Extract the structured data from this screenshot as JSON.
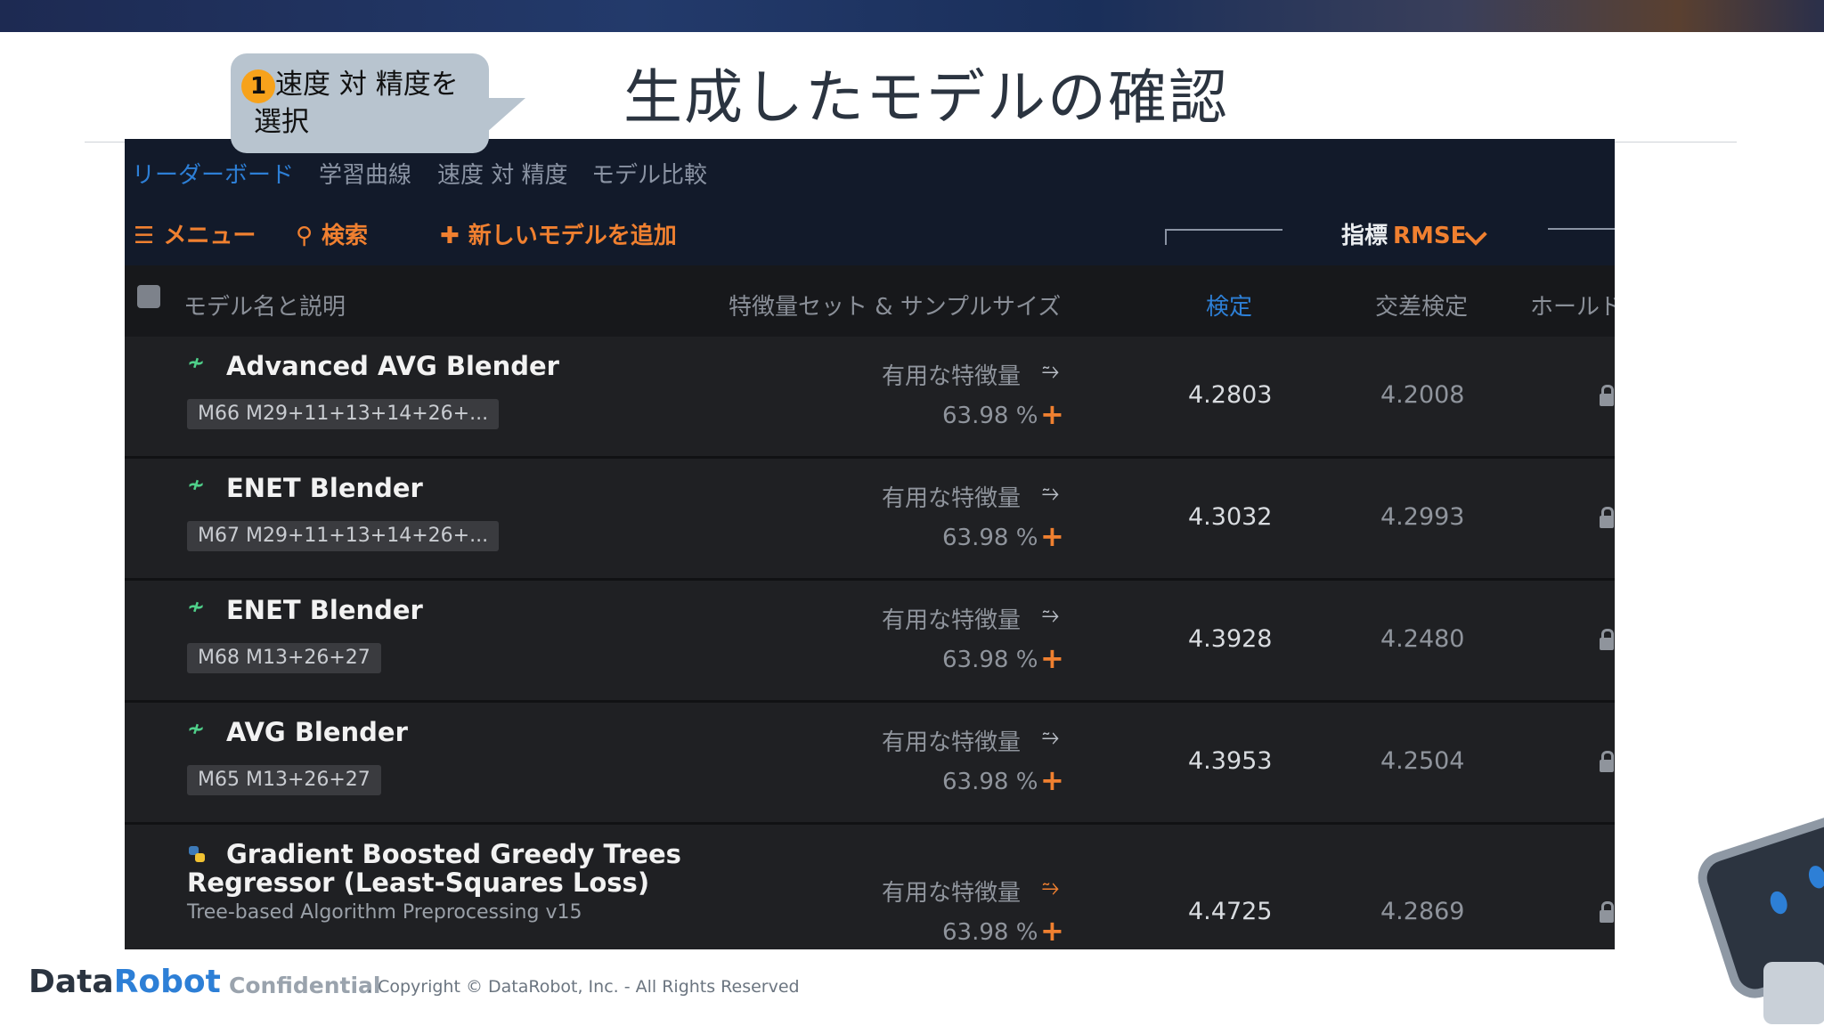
{
  "slide": {
    "title": "生成したモデルの確認",
    "callout_number": "1",
    "callout_text": "速度 対 精度を選択"
  },
  "tabs": [
    {
      "label": "リーダーボード",
      "active": true
    },
    {
      "label": "学習曲線",
      "active": false
    },
    {
      "label": "速度 対 精度",
      "active": false
    },
    {
      "label": "モデル比較",
      "active": false
    }
  ],
  "toolbar": {
    "menu_label": "メニュー",
    "search_label": "検索",
    "add_model_label": "新しいモデルを追加",
    "metric_label": "指標",
    "metric_value": "RMSE"
  },
  "columns": {
    "name": "モデル名と説明",
    "features": "特徴量セット & サンプルサイズ",
    "validation": "検定",
    "cross_validation": "交差検定",
    "holdout": "ホールド"
  },
  "rows": [
    {
      "name": "Advanced AVG Blender",
      "badge": "M66   M29+11+13+14+26+...",
      "feature_set": "有用な特徴量",
      "sample": "63.98 %",
      "validation": "4.2803",
      "cv": "4.2008"
    },
    {
      "name": "ENET Blender",
      "badge": "M67   M29+11+13+14+26+...",
      "feature_set": "有用な特徴量",
      "sample": "63.98 %",
      "validation": "4.3032",
      "cv": "4.2993"
    },
    {
      "name": "ENET Blender",
      "badge": "M68   M13+26+27",
      "feature_set": "有用な特徴量",
      "sample": "63.98 %",
      "validation": "4.3928",
      "cv": "4.2480"
    },
    {
      "name": "AVG Blender",
      "badge": "M65   M13+26+27",
      "feature_set": "有用な特徴量",
      "sample": "63.98 %",
      "validation": "4.3953",
      "cv": "4.2504"
    },
    {
      "name_line1": "Gradient Boosted Greedy Trees",
      "name_line2": "Regressor (Least-Squares Loss)",
      "description": "Tree-based Algorithm Preprocessing v15",
      "feature_set": "有用な特徴量",
      "sample": "63.98 %",
      "validation": "4.4725",
      "cv": "4.2869"
    }
  ],
  "footer": {
    "logo_data": "Data",
    "logo_robot": "Robot",
    "confidential": "Confidential",
    "copyright": ". Copyright © DataRobot, Inc. - All Rights Reserved"
  },
  "colors": {
    "accent_orange": "#f08030",
    "active_blue": "#2d7fd6",
    "app_bg": "#1f2023"
  }
}
